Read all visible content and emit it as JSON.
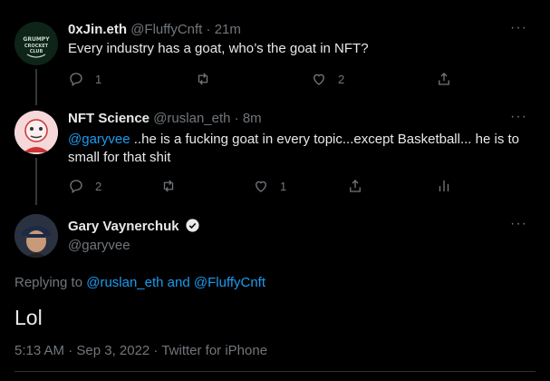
{
  "tweets": [
    {
      "name": "0xJin.eth",
      "handle": "@FluffyCnft",
      "time": "21m",
      "avatar_text": "GRUMPY CROCKET CLUB",
      "text": "Every industry has a goat, who’s the goat in NFT?",
      "reply_count": "1",
      "retweet_count": "",
      "like_count": "2"
    },
    {
      "name": "NFT Science",
      "handle": "@ruslan_eth",
      "time": "8m",
      "mention": "@garyvee",
      "text": " ..he is a fucking goat in every topic...except Basketball... he is to small for that shit",
      "reply_count": "2",
      "retweet_count": "",
      "like_count": "1"
    }
  ],
  "main_tweet": {
    "name": "Gary Vaynerchuk",
    "handle": "@garyvee",
    "replying_prefix": "Replying to ",
    "replying_to_1": "@ruslan_eth",
    "replying_and": " and ",
    "replying_to_2": "@FluffyCnft",
    "text": "Lol",
    "timestamp": "5:13 AM · Sep 3, 2022 · Twitter for iPhone"
  },
  "colors": {
    "accent": "#1d9bf0",
    "muted": "#71767b",
    "background": "#000000"
  }
}
